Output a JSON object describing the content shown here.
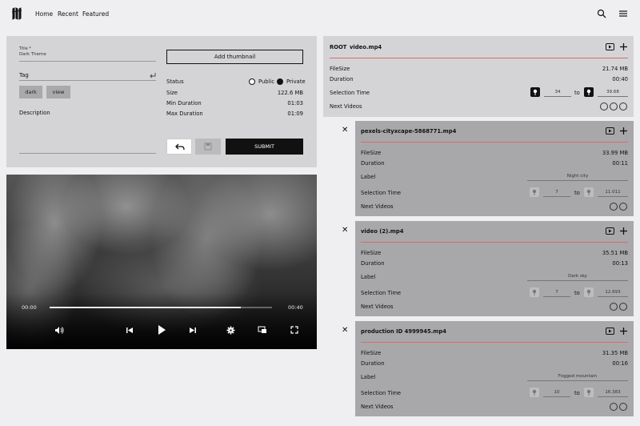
{
  "header": {
    "nav": [
      "Home",
      "Recent",
      "Featured"
    ]
  },
  "form": {
    "title_label": "Title *",
    "title_value": "Dark Theme",
    "tag_label": "Tag",
    "tags": [
      "dark",
      "view"
    ],
    "description_label": "Description",
    "add_thumbnail": "Add thumbnail",
    "status_label": "Status",
    "status_options": [
      "Public",
      "Private"
    ],
    "size_label": "Size",
    "size_value": "122.6 MB",
    "min_duration_label": "Min Duration",
    "min_duration_value": "01:03",
    "max_duration_label": "Max Duration",
    "max_duration_value": "01:09",
    "submit": "SUBMIT"
  },
  "player": {
    "current_time": "00:00",
    "total_time": "00:40",
    "progress": 0.86
  },
  "root_card": {
    "root_label": "ROOT",
    "file": "video.mp4",
    "filesize_label": "FileSize",
    "filesize": "21.74 MB",
    "duration_label": "Duration",
    "duration": "00:40",
    "selection_label": "Selection Time",
    "sel_start": "34",
    "to": "to",
    "sel_end": "39.68",
    "next_label": "Next Videos"
  },
  "sub_cards": [
    {
      "file": "pexels-cityxcape-5868771.mp4",
      "filesize_label": "FileSize",
      "filesize": "33.99 MB",
      "duration_label": "Duration",
      "duration": "00:11",
      "label_label": "Label",
      "label": "Night city",
      "selection_label": "Selection Time",
      "sel_start": "7",
      "to": "to",
      "sel_end": "11.011",
      "next_label": "Next Videos"
    },
    {
      "file": "video (2).mp4",
      "filesize_label": "FileSize",
      "filesize": "35.51 MB",
      "duration_label": "Duration",
      "duration": "00:13",
      "label_label": "Label",
      "label": "Dark sky",
      "selection_label": "Selection Time",
      "sel_start": "7",
      "to": "to",
      "sel_end": "12.693",
      "next_label": "Next Videos"
    },
    {
      "file": "production ID 4999945.mp4",
      "filesize_label": "FileSize",
      "filesize": "31.35 MB",
      "duration_label": "Duration",
      "duration": "00:16",
      "label_label": "Label",
      "label": "Fogged mountain",
      "selection_label": "Selection Time",
      "sel_start": "10",
      "to": "to",
      "sel_end": "16.383",
      "next_label": "Next Videos"
    }
  ],
  "colors": {
    "accent_red": "#d86a6a",
    "panel": "#d4d4d6",
    "sub_panel": "#a8a8aa",
    "background": "#efeff1"
  },
  "icons": [
    "logo-icon",
    "search-icon",
    "menu-icon",
    "undo-icon",
    "save-icon",
    "volume-icon",
    "previous-icon",
    "play-icon",
    "next-icon",
    "settings-icon",
    "pip-icon",
    "fullscreen-icon",
    "preview-icon",
    "add-icon",
    "close-icon",
    "pin-icon",
    "check-icon",
    "enter-icon"
  ]
}
